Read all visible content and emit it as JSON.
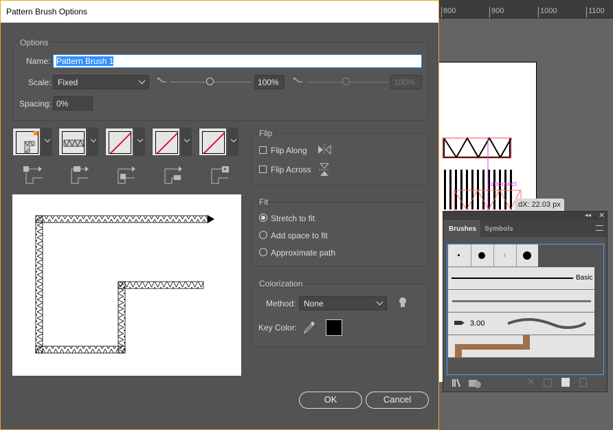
{
  "dialog": {
    "title": "Pattern Brush Options",
    "options": {
      "group_label": "Options",
      "name_label": "Name:",
      "name_value": "Pattern Brush 1",
      "scale_label": "Scale:",
      "scale_value": "Fixed",
      "scale_percent": "100%",
      "scale_percent2": "100%",
      "scale_slider_percent": 100,
      "spacing_label": "Spacing:",
      "spacing_value": "0%"
    },
    "tiles": [
      {
        "name": "side-tile"
      },
      {
        "name": "outer-corner-tile"
      },
      {
        "name": "inner-corner-tile"
      },
      {
        "name": "start-tile"
      },
      {
        "name": "end-tile"
      }
    ],
    "flip": {
      "group_label": "Flip",
      "along": "Flip Along",
      "across": "Flip Across",
      "along_checked": false,
      "across_checked": false
    },
    "fit": {
      "group_label": "Fit",
      "options": [
        "Stretch to fit",
        "Add space to fit",
        "Approximate path"
      ],
      "selected": "Stretch to fit"
    },
    "colorization": {
      "group_label": "Colorization",
      "method_label": "Method:",
      "method_value": "None",
      "key_color_label": "Key Color:",
      "key_color": "#000000"
    },
    "ok": "OK",
    "cancel": "Cancel",
    "accent": "#e8a81e"
  },
  "canvas": {
    "ruler": [
      "800",
      "900",
      "1000",
      "1100"
    ],
    "smart_guide": "intersect",
    "tooltip": "dX: 22.03 px"
  },
  "brushes_panel": {
    "tabs": [
      "Brushes",
      "Symbols"
    ],
    "active_tab": "Brushes",
    "basic_label": "Basic",
    "brush_size": "3.00"
  }
}
